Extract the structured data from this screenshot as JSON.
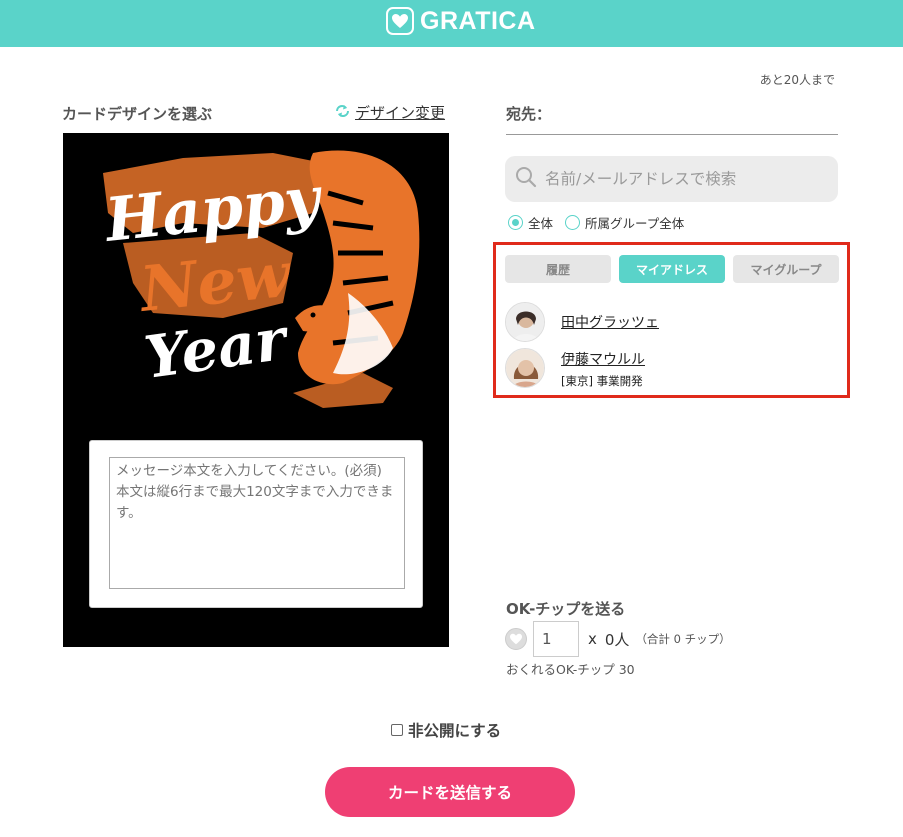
{
  "app": {
    "brand": "GRATICA",
    "accent_color": "#5ad3c9",
    "send_color": "#ef3f73",
    "highlight_color": "#e02a1b"
  },
  "design": {
    "section_label": "カードデザインを選ぶ",
    "change_link": "デザイン変更",
    "card_art_lettering": "Happy New Year",
    "message_placeholder": "メッセージ本文を入力してください。(必須)\n本文は縦6行まで最大120文字まで入力できます。"
  },
  "recipient": {
    "remaining": "あと20人まで",
    "label": "宛先：",
    "search_placeholder": "名前/メールアドレスで検索",
    "scope_options": [
      {
        "label": "全体",
        "selected": true
      },
      {
        "label": "所属グループ全体",
        "selected": false
      }
    ],
    "tabs": [
      {
        "label": "履歴",
        "active": false
      },
      {
        "label": "マイアドレス",
        "active": true
      },
      {
        "label": "マイグループ",
        "active": false
      }
    ],
    "contacts": [
      {
        "name": "田中グラッツェ",
        "sub": ""
      },
      {
        "name": "伊藤マウルル",
        "sub": "[東京] 事業開発"
      }
    ]
  },
  "chip": {
    "title": "OK-チップを送る",
    "quantity": "1",
    "times": "x",
    "people": "0人",
    "total": "（合計 0 チップ）",
    "remaining": "おくれるOK-チップ 30"
  },
  "private_label": "非公開にする",
  "send_label": "カードを送信する"
}
